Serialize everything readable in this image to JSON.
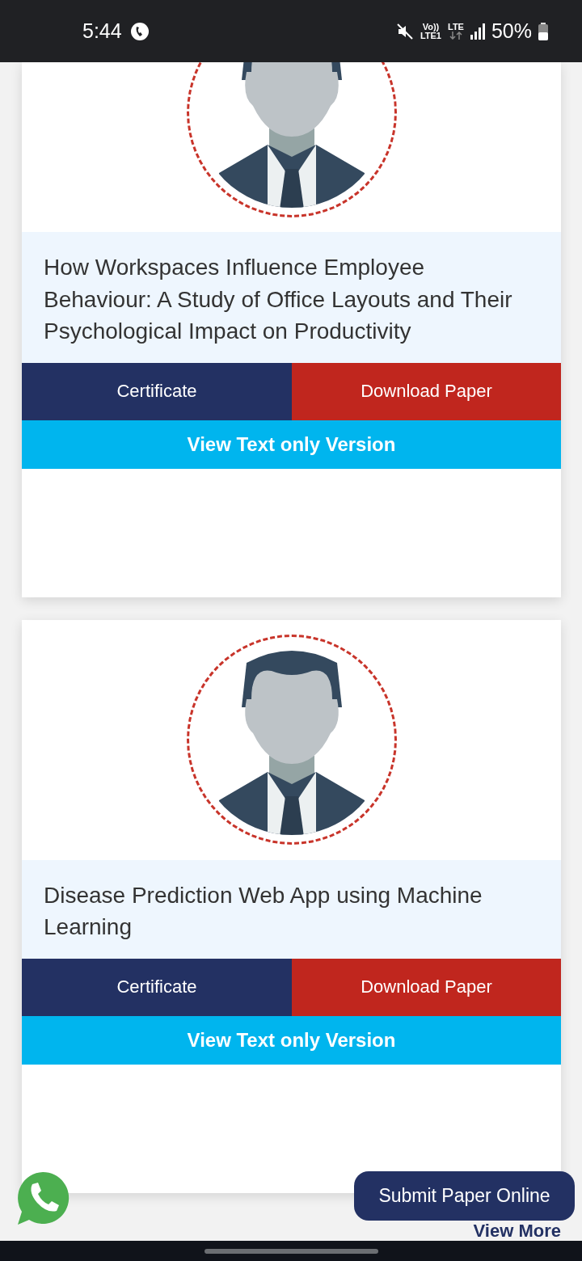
{
  "status_bar": {
    "time": "5:44",
    "volte_top": "Vo))",
    "volte_bottom": "LTE1",
    "lte": "LTE",
    "battery": "50%"
  },
  "papers": [
    {
      "title": "How Workspaces Influence Employee Behaviour: A Study of Office Layouts and Their Psychological Impact on Productivity",
      "certificate": "Certificate",
      "download": "Download Paper",
      "text_version": "View Text only Version",
      "cut_top": true
    },
    {
      "title": "Disease Prediction Web App using Machine Learning",
      "certificate": "Certificate",
      "download": "Download Paper",
      "text_version": "View Text only Version",
      "cut_top": false
    }
  ],
  "submit_button": "Submit Paper Online",
  "view_more": "View More"
}
